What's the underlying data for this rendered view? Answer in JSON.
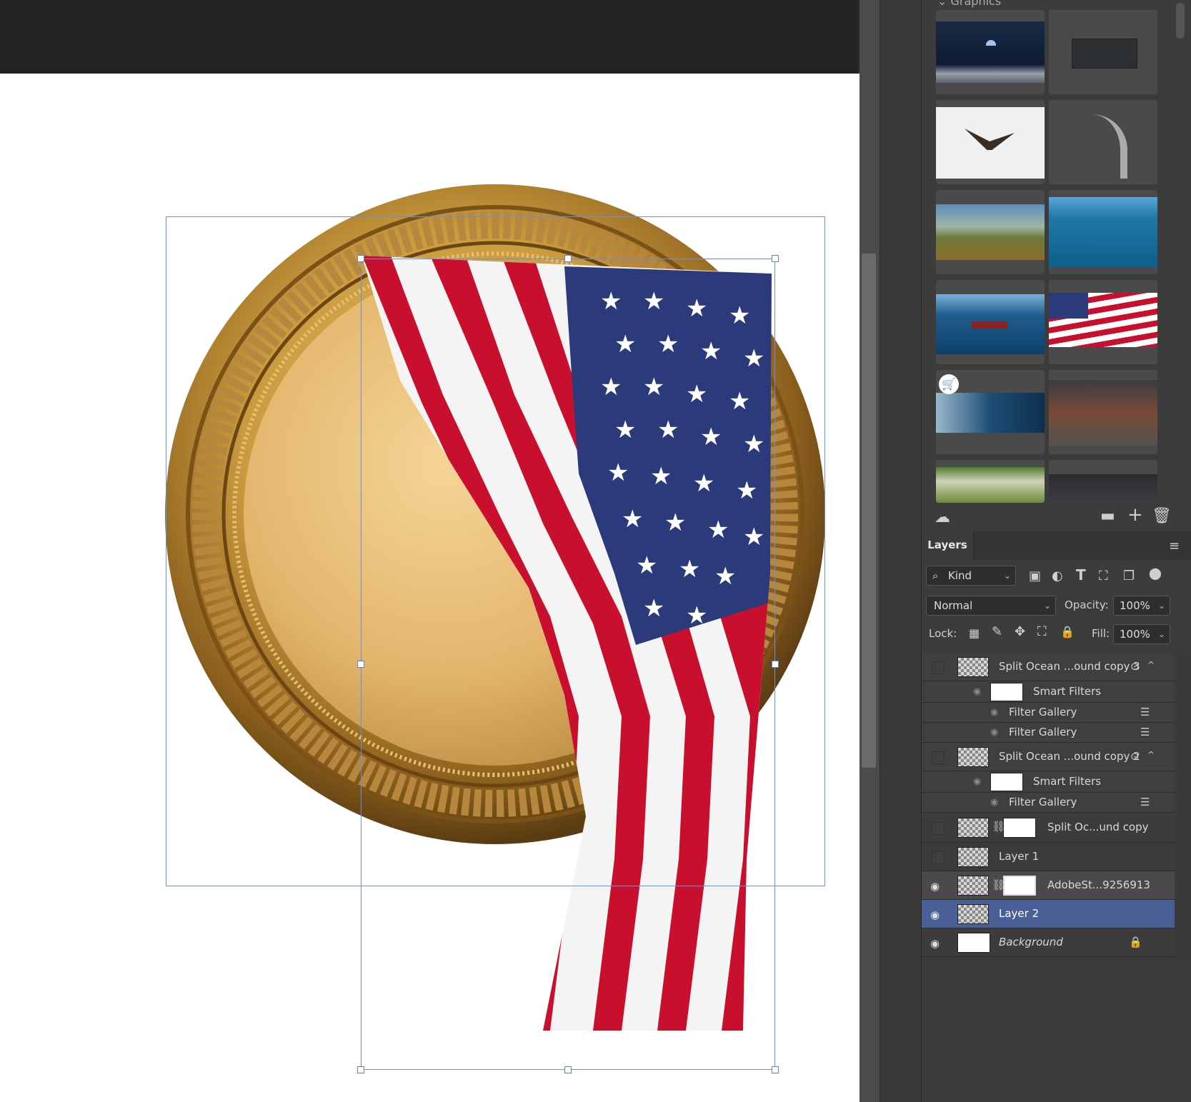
{
  "library": {
    "section_title": "Graphics",
    "thumbnails": [
      {
        "name": "moon-earth-thumbnail"
      },
      {
        "name": "shipping-container-thumbnail"
      },
      {
        "name": "eagle-thumbnail"
      },
      {
        "name": "rocket-launch-thumbnail"
      },
      {
        "name": "wildfire-field-thumbnail"
      },
      {
        "name": "ocean-horizon-thumbnail"
      },
      {
        "name": "cargo-ship-thumbnail"
      },
      {
        "name": "american-flag-thumbnail"
      },
      {
        "name": "statue-globe-thumbnail"
      },
      {
        "name": "warehouse-interior-thumbnail"
      },
      {
        "name": "garden-thumbnail"
      },
      {
        "name": "garage-interior-thumbnail"
      }
    ]
  },
  "layers_panel": {
    "tab_label": "Layers",
    "filter_kind": "Kind",
    "blend_mode": "Normal",
    "opacity_label": "Opacity:",
    "opacity_value": "100%",
    "lock_label": "Lock:",
    "fill_label": "Fill:",
    "fill_value": "100%",
    "layers": [
      {
        "name": "Split Ocean ...ound copy 3",
        "visible": false,
        "type": "smart"
      },
      {
        "name": "Smart Filters",
        "type": "smart-filters"
      },
      {
        "name": "Filter Gallery",
        "type": "filter"
      },
      {
        "name": "Filter Gallery",
        "type": "filter"
      },
      {
        "name": "Split Ocean ...ound copy 2",
        "visible": false,
        "type": "smart"
      },
      {
        "name": "Smart Filters",
        "type": "smart-filters"
      },
      {
        "name": "Filter Gallery",
        "type": "filter"
      },
      {
        "name": "Split Oc...und copy",
        "visible": false,
        "type": "smart-mask"
      },
      {
        "name": "Layer 1",
        "visible": false,
        "type": "pixel"
      },
      {
        "name": "AdobeSt...9256913",
        "visible": true,
        "type": "smart-mask"
      },
      {
        "name": "Layer 2",
        "visible": true,
        "type": "pixel",
        "selected": true
      },
      {
        "name": "Background",
        "visible": true,
        "type": "background",
        "locked": true
      }
    ]
  },
  "colors": {
    "selection_blue": "#6a8fdc",
    "selected_layer": "#4a5f95",
    "panel_bg": "#3c3c3c"
  }
}
